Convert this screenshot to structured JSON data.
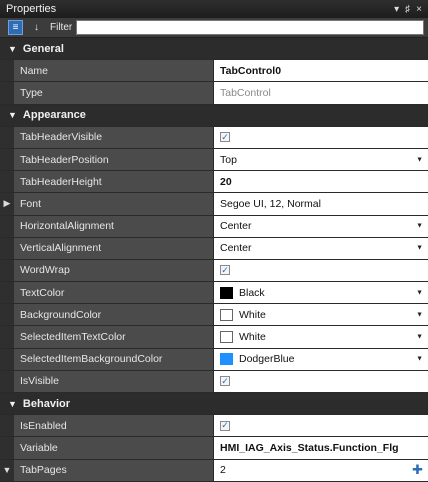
{
  "window": {
    "title": "Properties",
    "buttons": [
      "▾",
      "♯",
      "×"
    ]
  },
  "toolbar": {
    "filter_label": "Filter",
    "filter_value": ""
  },
  "categories": {
    "general": "General",
    "appearance": "Appearance",
    "behavior": "Behavior"
  },
  "general": {
    "name": {
      "label": "Name",
      "value": "TabControl0"
    },
    "type": {
      "label": "Type",
      "value": "TabControl"
    }
  },
  "appearance": {
    "tab_header_visible": {
      "label": "TabHeaderVisible",
      "checked": true
    },
    "tab_header_position": {
      "label": "TabHeaderPosition",
      "value": "Top"
    },
    "tab_header_height": {
      "label": "TabHeaderHeight",
      "value": "20"
    },
    "font": {
      "label": "Font",
      "value": "Segoe UI, 12, Normal"
    },
    "horizontal_alignment": {
      "label": "HorizontalAlignment",
      "value": "Center"
    },
    "vertical_alignment": {
      "label": "VerticalAlignment",
      "value": "Center"
    },
    "word_wrap": {
      "label": "WordWrap",
      "checked": true
    },
    "text_color": {
      "label": "TextColor",
      "value": "Black",
      "color": "#000000"
    },
    "background_color": {
      "label": "BackgroundColor",
      "value": "White",
      "color": "#ffffff"
    },
    "selected_item_text_color": {
      "label": "SelectedItemTextColor",
      "value": "White",
      "color": "#ffffff"
    },
    "selected_item_background_color": {
      "label": "SelectedItemBackgroundColor",
      "value": "DodgerBlue",
      "color": "#1e90ff"
    },
    "is_visible": {
      "label": "IsVisible",
      "checked": true
    }
  },
  "behavior": {
    "is_enabled": {
      "label": "IsEnabled",
      "checked": true
    },
    "variable": {
      "label": "Variable",
      "value": "HMI_IAG_Axis_Status.Function_Flg"
    },
    "tab_pages": {
      "label": "TabPages",
      "value": "2"
    }
  },
  "glyphs": {
    "expanded": "▼",
    "collapsed": "▶",
    "dropdown": "▼",
    "check": "✓",
    "add": "✚"
  }
}
